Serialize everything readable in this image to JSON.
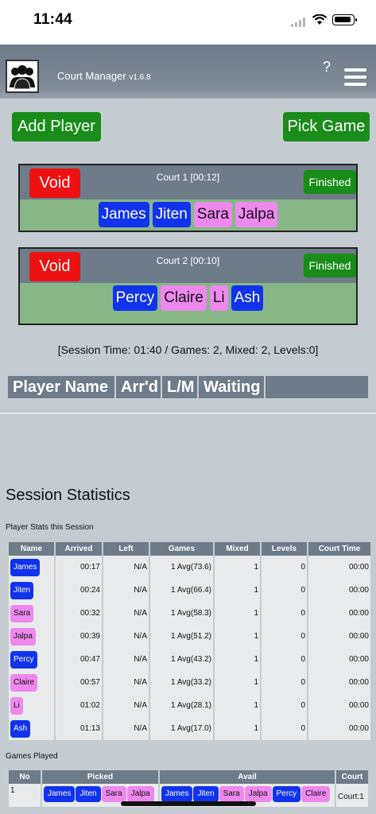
{
  "status_bar": {
    "time": "11:44"
  },
  "header": {
    "app_name": "Court Manager",
    "version": "v1.6.8",
    "help": "?"
  },
  "actions": {
    "add_player": "Add Player",
    "pick_game": "Pick Game"
  },
  "courts": [
    {
      "title": "Court 1 [00:12]",
      "void": "Void",
      "finished": "Finished",
      "players": [
        {
          "name": "James",
          "g": "m"
        },
        {
          "name": "Jiten",
          "g": "m"
        },
        {
          "name": "Sara",
          "g": "f"
        },
        {
          "name": "Jalpa",
          "g": "f"
        }
      ]
    },
    {
      "title": "Court 2 [00:10]",
      "void": "Void",
      "finished": "Finished",
      "players": [
        {
          "name": "Percy",
          "g": "m"
        },
        {
          "name": "Claire",
          "g": "f"
        },
        {
          "name": "Li",
          "g": "f"
        },
        {
          "name": "Ash",
          "g": "m"
        }
      ]
    }
  ],
  "session_line": "[Session Time: 01:40 / Games: 2, Mixed: 2, Levels:0]",
  "roster_headers": [
    "Player Name",
    "Arr'd",
    "L/M",
    "Waiting",
    ""
  ],
  "stats": {
    "title": "Session Statistics",
    "subtitle": "Player Stats this Session",
    "headers": [
      "Name",
      "Arrived",
      "Left",
      "Games",
      "Mixed",
      "Levels",
      "Court Time"
    ],
    "rows": [
      {
        "name": "James",
        "g": "m",
        "arrived": "00:17",
        "left": "N/A",
        "games": "1 Avg(73.6)",
        "mixed": "1",
        "levels": "0",
        "court_time": "00:00"
      },
      {
        "name": "Jiten",
        "g": "m",
        "arrived": "00:24",
        "left": "N/A",
        "games": "1 Avg(66.4)",
        "mixed": "1",
        "levels": "0",
        "court_time": "00:00"
      },
      {
        "name": "Sara",
        "g": "f",
        "arrived": "00:32",
        "left": "N/A",
        "games": "1 Avg(58.3)",
        "mixed": "1",
        "levels": "0",
        "court_time": "00:00"
      },
      {
        "name": "Jalpa",
        "g": "f",
        "arrived": "00:39",
        "left": "N/A",
        "games": "1 Avg(51.2)",
        "mixed": "1",
        "levels": "0",
        "court_time": "00:00"
      },
      {
        "name": "Percy",
        "g": "m",
        "arrived": "00:47",
        "left": "N/A",
        "games": "1 Avg(43.2)",
        "mixed": "1",
        "levels": "0",
        "court_time": "00:00"
      },
      {
        "name": "Claire",
        "g": "f",
        "arrived": "00:57",
        "left": "N/A",
        "games": "1 Avg(33.2)",
        "mixed": "1",
        "levels": "0",
        "court_time": "00:00"
      },
      {
        "name": "Li",
        "g": "f",
        "arrived": "01:02",
        "left": "N/A",
        "games": "1 Avg(28.1)",
        "mixed": "1",
        "levels": "0",
        "court_time": "00:00"
      },
      {
        "name": "Ash",
        "g": "m",
        "arrived": "01:13",
        "left": "N/A",
        "games": "1 Avg(17.0)",
        "mixed": "1",
        "levels": "0",
        "court_time": "00:00"
      }
    ]
  },
  "games": {
    "title": "Games Played",
    "headers": [
      "No",
      "Picked",
      "Avail",
      "Court"
    ],
    "rows": [
      {
        "no": "1",
        "picked": [
          {
            "name": "James",
            "g": "m"
          },
          {
            "name": "Jiten",
            "g": "m"
          },
          {
            "name": "Sara",
            "g": "f"
          },
          {
            "name": "Jalpa",
            "g": "f"
          }
        ],
        "avail": [
          {
            "name": "James",
            "g": "m"
          },
          {
            "name": "Jiten",
            "g": "m"
          },
          {
            "name": "Sara",
            "g": "f"
          },
          {
            "name": "Jalpa",
            "g": "f"
          },
          {
            "name": "Percy",
            "g": "m"
          },
          {
            "name": "Claire",
            "g": "f"
          }
        ],
        "court": "Court:1"
      }
    ]
  }
}
